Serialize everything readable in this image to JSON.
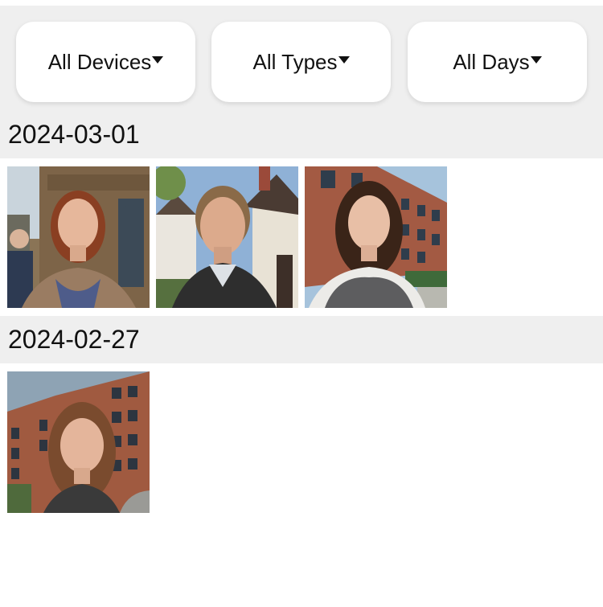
{
  "filters": {
    "devices": {
      "label": "All Devices",
      "icon": "caret-down-icon"
    },
    "types": {
      "label": "All Types",
      "icon": "caret-down-icon"
    },
    "days": {
      "label": "All Days",
      "icon": "caret-down-icon"
    }
  },
  "sections": [
    {
      "date": "2024-03-01",
      "photos": [
        {
          "subject": "woman with auburn bob, man in background, stone building"
        },
        {
          "subject": "smiling man, tudor houses, blue sky"
        },
        {
          "subject": "young woman with long dark hair, brick apartments"
        }
      ]
    },
    {
      "date": "2024-02-27",
      "photos": [
        {
          "subject": "young woman with long brown hair, brick apartment block"
        }
      ]
    }
  ],
  "colors": {
    "header_bg": "#efefef",
    "page_bg": "#ffffff",
    "text": "#111111"
  }
}
